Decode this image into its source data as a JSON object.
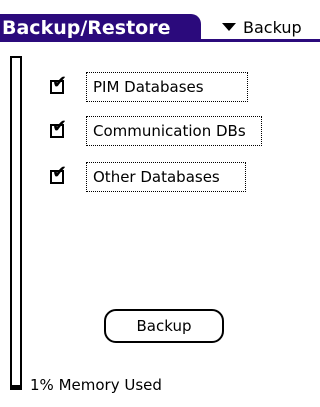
{
  "title": "Backup/Restore",
  "dropdown": {
    "icon": "triangle-down-icon",
    "label": "Backup"
  },
  "options": [
    {
      "checked": true,
      "label": "PIM Databases"
    },
    {
      "checked": true,
      "label": "Communication DBs"
    },
    {
      "checked": true,
      "label": "Other Databases"
    }
  ],
  "check_glyph": "✔",
  "action_button": "Backup",
  "memory": {
    "label": "1% Memory Used",
    "percent": 1
  },
  "colors": {
    "title_bg": "#2b0a7c",
    "title_text": "#ffffff"
  }
}
